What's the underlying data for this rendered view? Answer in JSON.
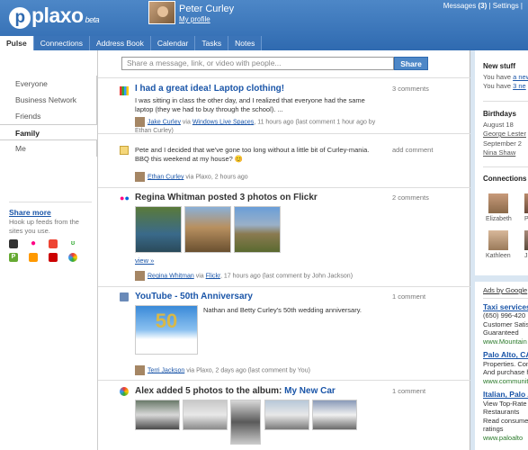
{
  "header": {
    "logo": "plaxo",
    "logo_badge": "beta",
    "user_name": "Peter Curley",
    "my_profile": "My profile",
    "messages": "Messages",
    "messages_count": "(3)",
    "settings": "Settings"
  },
  "tabs": [
    "Pulse",
    "Connections",
    "Address Book",
    "Calendar",
    "Tasks",
    "Notes"
  ],
  "left": {
    "nav": [
      "Everyone",
      "Business Network",
      "Friends",
      "Family",
      "Me"
    ],
    "share_more_title": "Share more",
    "share_more_desc": "Hook up feeds from the sites you use."
  },
  "share": {
    "placeholder": "Share a message, link, or video with people...",
    "button": "Share"
  },
  "posts": [
    {
      "title": "I had a great idea! Laptop clothing!",
      "text": "I was sitting in class the other day, and I realized that everyone had the same laptop (they we had to buy through the school). ...",
      "count": "3 comments",
      "author": "Jake Curley",
      "via": "via",
      "source": "Windows Live Spaces",
      "meta": ", 11 hours ago (last comment 1 hour ago by Ethan Curley)"
    },
    {
      "text": "Pete and I decided that we've gone too long without a little bit of Curley-mania. BBQ this weekend at my house? 😊",
      "count": "add comment",
      "author": "Ethan Curley",
      "meta": "via Plaxo, 2 hours ago"
    },
    {
      "title": "Regina Whitman posted 3 photos on Flickr",
      "count": "2 comments",
      "view": "view »",
      "author": "Regina Whitman",
      "via": "via",
      "source": "Flickr",
      "meta": ", 17 hours ago (last comment by John Jackson)"
    },
    {
      "title": "YouTube - 50th Anniversary",
      "text": "Nathan and Betty Curley's 50th wedding anniversary.",
      "count": "1 comment",
      "author": "Terri Jackson",
      "meta": "via Plaxo, 2 days ago (last comment by You)",
      "image_text": "50"
    },
    {
      "title_prefix": "Alex added 5 photos to the album:",
      "title_link": "My New Car",
      "count": "1 comment"
    }
  ],
  "right": {
    "new_stuff": "New stuff",
    "new_line1_prefix": "You have",
    "new_line1_link": "a new",
    "new_line2_prefix": "You have",
    "new_line2_link": "3 ne",
    "birthdays": "Birthdays",
    "bday1_date": "August 18",
    "bday1_name": "George Lester",
    "bday2_date": "September 2",
    "bday2_name": "Nina Shaw",
    "connections": "Connections",
    "conn_names": [
      "Elizabeth",
      "Pe",
      "Kathleen",
      "Ji"
    ],
    "ads_by": "Ads by Google",
    "ads": [
      {
        "title": "Taxi services",
        "lines": [
          "(650) 996-420",
          "Customer Satis",
          "Guaranteed"
        ],
        "url": "www.Mountain"
      },
      {
        "title": "Palo Alto, CA",
        "lines": [
          "Properties. Con",
          "And purchase h"
        ],
        "url": "www.communit"
      },
      {
        "title": "Italian, Palo A",
        "lines": [
          "View Top-Rate",
          "Restaurants",
          "Read consume",
          "ratings"
        ],
        "url": "www.paloalto"
      }
    ]
  },
  "colors": {
    "header": "#3b74b8",
    "link": "#1a55a8",
    "button": "#4d87c7"
  }
}
